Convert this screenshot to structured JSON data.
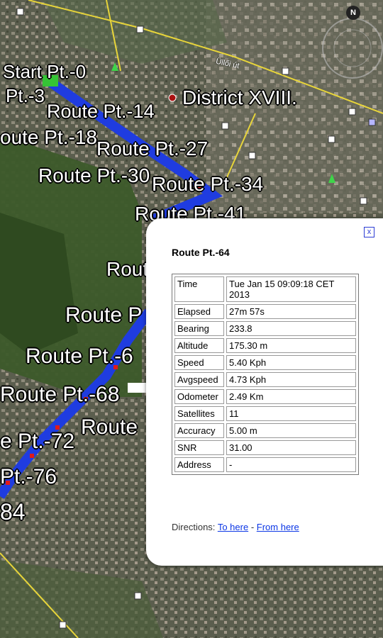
{
  "compass": {
    "label": "N"
  },
  "map": {
    "road_label": "Üllői út",
    "place": {
      "name": "District XVIII."
    },
    "route_labels": [
      "Start Pt.-0",
      "Pt.-3",
      "Route Pt.-14",
      "oute Pt.-18",
      "Route Pt.-27",
      "Route Pt.-30",
      "Route Pt.-34",
      "Route Pt.-41",
      "Route",
      "Route P",
      "Route Pt.-6",
      "Route Pt.-68",
      "Route",
      "e Pt.-72",
      "Pt.-76",
      "84"
    ]
  },
  "popup": {
    "title": "Route Pt.-64",
    "close_label": "x",
    "rows": [
      {
        "key": "Time",
        "value": "Tue Jan 15 09:09:18 CET 2013"
      },
      {
        "key": "Elapsed",
        "value": "27m 57s"
      },
      {
        "key": "Bearing",
        "value": "233.8"
      },
      {
        "key": "Altitude",
        "value": "175.30 m"
      },
      {
        "key": "Speed",
        "value": "5.40 Kph"
      },
      {
        "key": "Avgspeed",
        "value": "4.73 Kph"
      },
      {
        "key": "Odometer",
        "value": "2.49 Km"
      },
      {
        "key": "Satellites",
        "value": "11"
      },
      {
        "key": "Accuracy",
        "value": "5.00 m"
      },
      {
        "key": "SNR",
        "value": "31.00"
      },
      {
        "key": "Address",
        "value": "-"
      }
    ],
    "directions_label": "Directions:",
    "to_here": "To here",
    "separator": "-",
    "from_here": "From here"
  },
  "colors": {
    "route_blue": "#1f3ce0",
    "route_red": "#e01a1a",
    "road_yellow": "#e8d53a",
    "link_blue": "#0b36e6"
  }
}
